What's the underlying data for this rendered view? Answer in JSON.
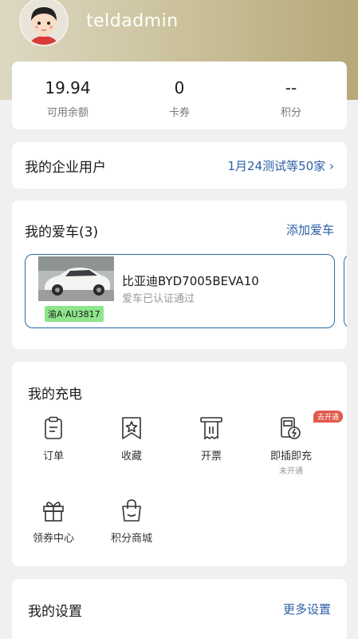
{
  "profile": {
    "username": "teldadmin"
  },
  "stats": [
    {
      "value": "19.94",
      "label": "可用余额"
    },
    {
      "value": "0",
      "label": "卡券"
    },
    {
      "value": "--",
      "label": "积分"
    }
  ],
  "enterprise": {
    "title": "我的企业用户",
    "link": "1月24测试等50家 ›"
  },
  "cars": {
    "title": "我的爱车(3)",
    "add_label": "添加爱车",
    "items": [
      {
        "plate": "渝A·AU3817",
        "name": "比亚迪BYD7005BEVA10",
        "status": "爱车已认证通过"
      }
    ]
  },
  "charging": {
    "title": "我的充电",
    "items": [
      {
        "label": "订单",
        "icon": "clipboard-icon"
      },
      {
        "label": "收藏",
        "icon": "bookmark-star-icon"
      },
      {
        "label": "开票",
        "icon": "invoice-icon"
      },
      {
        "label": "即插即充",
        "sub": "未开通",
        "badge": "去开通",
        "icon": "plug-charge-icon"
      },
      {
        "label": "领券中心",
        "icon": "gift-icon"
      },
      {
        "label": "积分商城",
        "icon": "shopping-bag-icon"
      }
    ]
  },
  "settings": {
    "title": "我的设置",
    "link": "更多设置"
  },
  "colors": {
    "accent": "#2b5fa6",
    "header_gold": "#b5a879",
    "plate_green": "#8ee58c",
    "badge_red": "#e25a4b"
  }
}
